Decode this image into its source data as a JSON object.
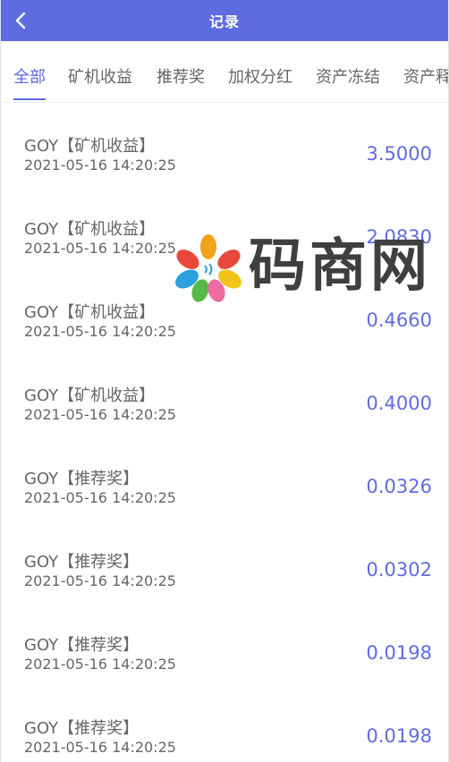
{
  "header": {
    "title": "记录",
    "back_icon": "chevron-left-icon"
  },
  "tabs": [
    {
      "label": "全部",
      "active": true
    },
    {
      "label": "矿机收益",
      "active": false
    },
    {
      "label": "推荐奖",
      "active": false
    },
    {
      "label": "加权分红",
      "active": false
    },
    {
      "label": "资产冻结",
      "active": false
    },
    {
      "label": "资产释放",
      "active": false
    }
  ],
  "records": [
    {
      "name": "GOY【矿机收益】",
      "date": "2021-05-16 14:20:25",
      "amount": "3.5000"
    },
    {
      "name": "GOY【矿机收益】",
      "date": "2021-05-16 14:20:25",
      "amount": "2.0830"
    },
    {
      "name": "GOY【矿机收益】",
      "date": "2021-05-16 14:20:25",
      "amount": "0.4660"
    },
    {
      "name": "GOY【矿机收益】",
      "date": "2021-05-16 14:20:25",
      "amount": "0.4000"
    },
    {
      "name": "GOY【推荐奖】",
      "date": "2021-05-16 14:20:25",
      "amount": "0.0326"
    },
    {
      "name": "GOY【推荐奖】",
      "date": "2021-05-16 14:20:25",
      "amount": "0.0302"
    },
    {
      "name": "GOY【推荐奖】",
      "date": "2021-05-16 14:20:25",
      "amount": "0.0198"
    },
    {
      "name": "GOY【推荐奖】",
      "date": "2021-05-16 14:20:25",
      "amount": "0.0198"
    }
  ],
  "watermark": {
    "text": "码商网"
  },
  "colors": {
    "accent": "#5f6be1",
    "text_gray": "#666666"
  }
}
